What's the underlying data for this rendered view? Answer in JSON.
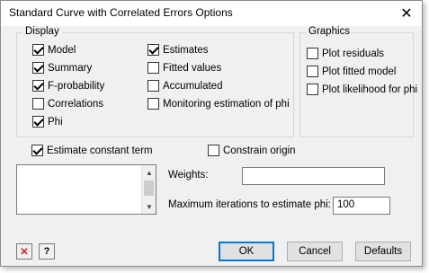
{
  "window": {
    "title": "Standard Curve with Correlated Errors Options"
  },
  "display": {
    "title": "Display",
    "items": [
      {
        "label": "Model",
        "checked": true
      },
      {
        "label": "Summary",
        "checked": true
      },
      {
        "label": "F-probability",
        "checked": true
      },
      {
        "label": "Correlations",
        "checked": false
      },
      {
        "label": "Phi",
        "checked": true
      },
      {
        "label": "Estimates",
        "checked": true
      },
      {
        "label": "Fitted values",
        "checked": false
      },
      {
        "label": "Accumulated",
        "checked": false
      },
      {
        "label": "Monitoring estimation of phi",
        "checked": false
      }
    ]
  },
  "graphics": {
    "title": "Graphics",
    "items": [
      {
        "label": "Plot residuals",
        "checked": false
      },
      {
        "label": "Plot fitted model",
        "checked": false
      },
      {
        "label": "Plot likelihood for phi",
        "checked": false
      }
    ]
  },
  "options": {
    "estimate_constant": {
      "label": "Estimate constant term",
      "checked": true
    },
    "constrain_origin": {
      "label": "Constrain origin",
      "checked": false
    }
  },
  "weights": {
    "label": "Weights:",
    "value": ""
  },
  "max_iter": {
    "label": "Maximum iterations to estimate phi:",
    "value": "100"
  },
  "buttons": {
    "ok": "OK",
    "cancel": "Cancel",
    "defaults": "Defaults"
  },
  "icons": {
    "close": "close-icon",
    "clear": "clear-icon",
    "help": "help-icon"
  },
  "colors": {
    "clear_icon": "#cc2222",
    "default_button_border": "#0078d7"
  }
}
